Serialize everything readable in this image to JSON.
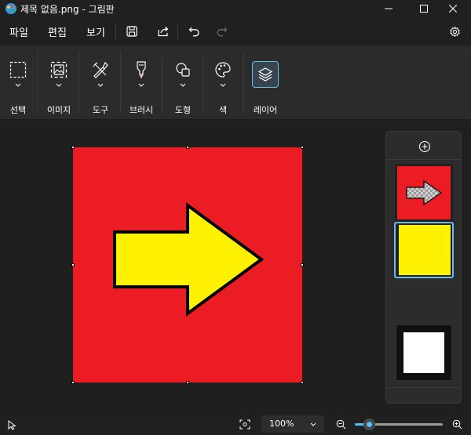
{
  "window": {
    "title": "제목 없음.png - 그림판"
  },
  "menu": {
    "items": [
      "파일",
      "편집",
      "보기"
    ]
  },
  "ribbon": {
    "tools": [
      {
        "label": "선택",
        "icon": "selection-icon"
      },
      {
        "label": "이미지",
        "icon": "image-icon"
      },
      {
        "label": "도구",
        "icon": "tools-icon"
      },
      {
        "label": "브러시",
        "icon": "brush-icon"
      },
      {
        "label": "도형",
        "icon": "shapes-icon"
      },
      {
        "label": "색",
        "icon": "palette-icon"
      },
      {
        "label": "레이어",
        "icon": "layers-icon"
      }
    ]
  },
  "canvas": {
    "background_color": "#ec1c24",
    "arrow_color": "#fff200",
    "arrow_direction": "right"
  },
  "layers": {
    "items": [
      {
        "name": "arrow-layer",
        "selected": false
      },
      {
        "name": "yellow-layer",
        "selected": true
      },
      {
        "name": "white-layer",
        "selected": false
      }
    ]
  },
  "status": {
    "zoom": "100%",
    "zoom_fraction": 0.1
  },
  "colors": {
    "accent": "#4cc2ff",
    "titlebar": "#202020",
    "ribbon": "#2b2b2b"
  }
}
